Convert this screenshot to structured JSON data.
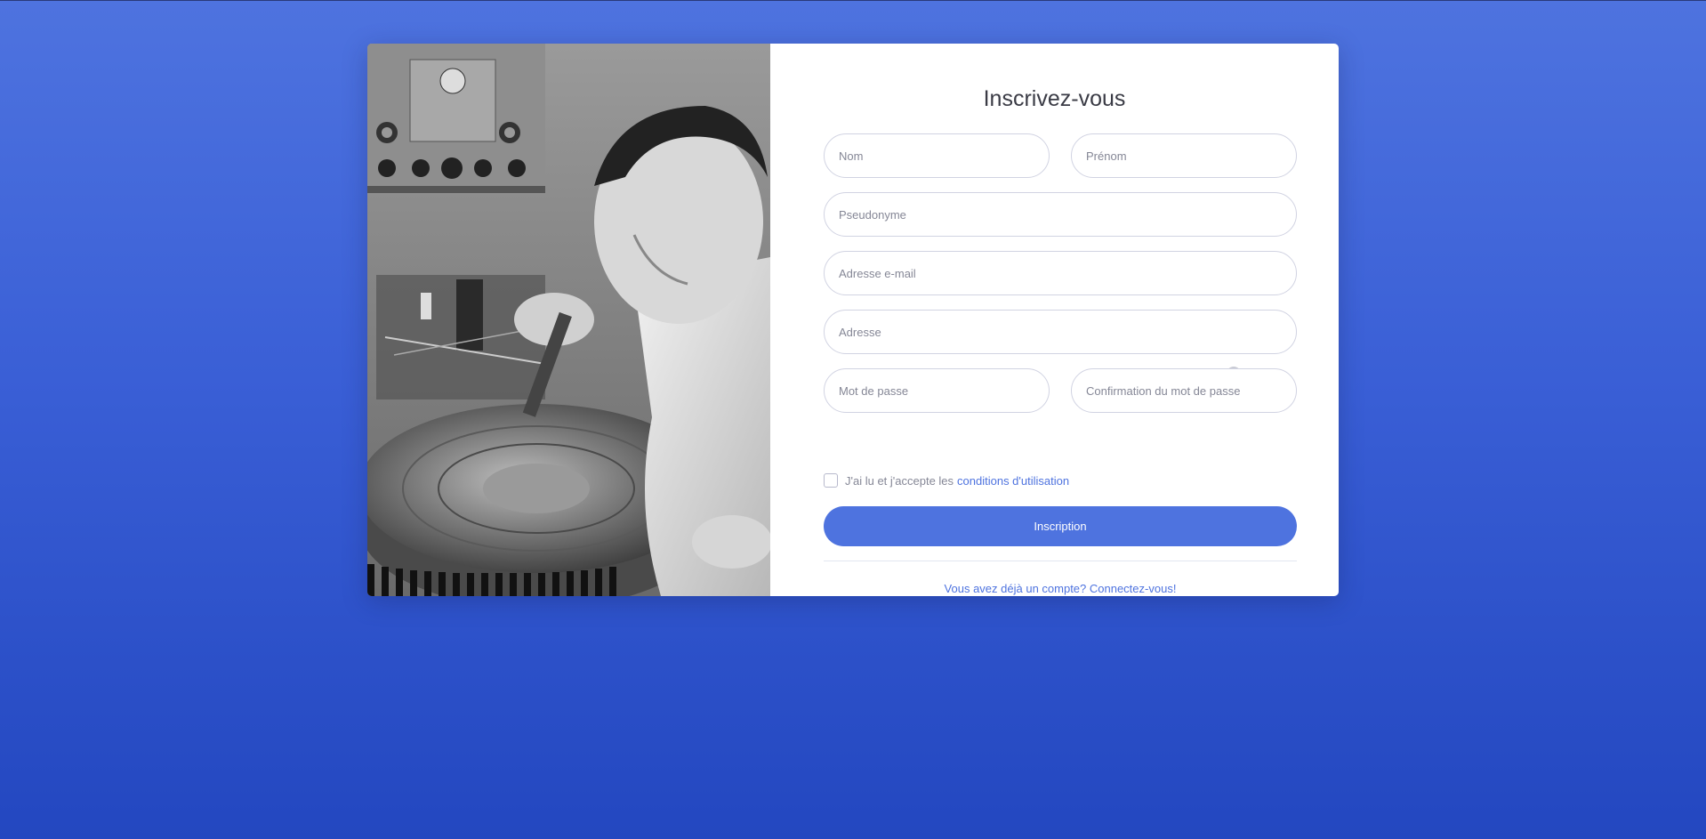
{
  "form": {
    "title": "Inscrivez-vous",
    "fields": {
      "nom": "Nom",
      "prenom": "Prénom",
      "pseudonyme": "Pseudonyme",
      "email": "Adresse e-mail",
      "adresse": "Adresse",
      "password": "Mot de passe",
      "password_confirm": "Confirmation du mot de passe"
    },
    "terms": {
      "text": "J'ai lu et j'accepte les",
      "link": "conditions d'utilisation",
      "checked": false
    },
    "submit_label": "Inscription",
    "login_link": "Vous avez déjà un compte? Connectez-vous!"
  },
  "icons": {
    "address_icon": "map-pin-icon"
  },
  "colors": {
    "primary": "#4e73df",
    "background_top": "#4e73df",
    "background_bottom": "#2347c0",
    "input_border": "#d1d3e2",
    "text_muted": "#858796"
  }
}
